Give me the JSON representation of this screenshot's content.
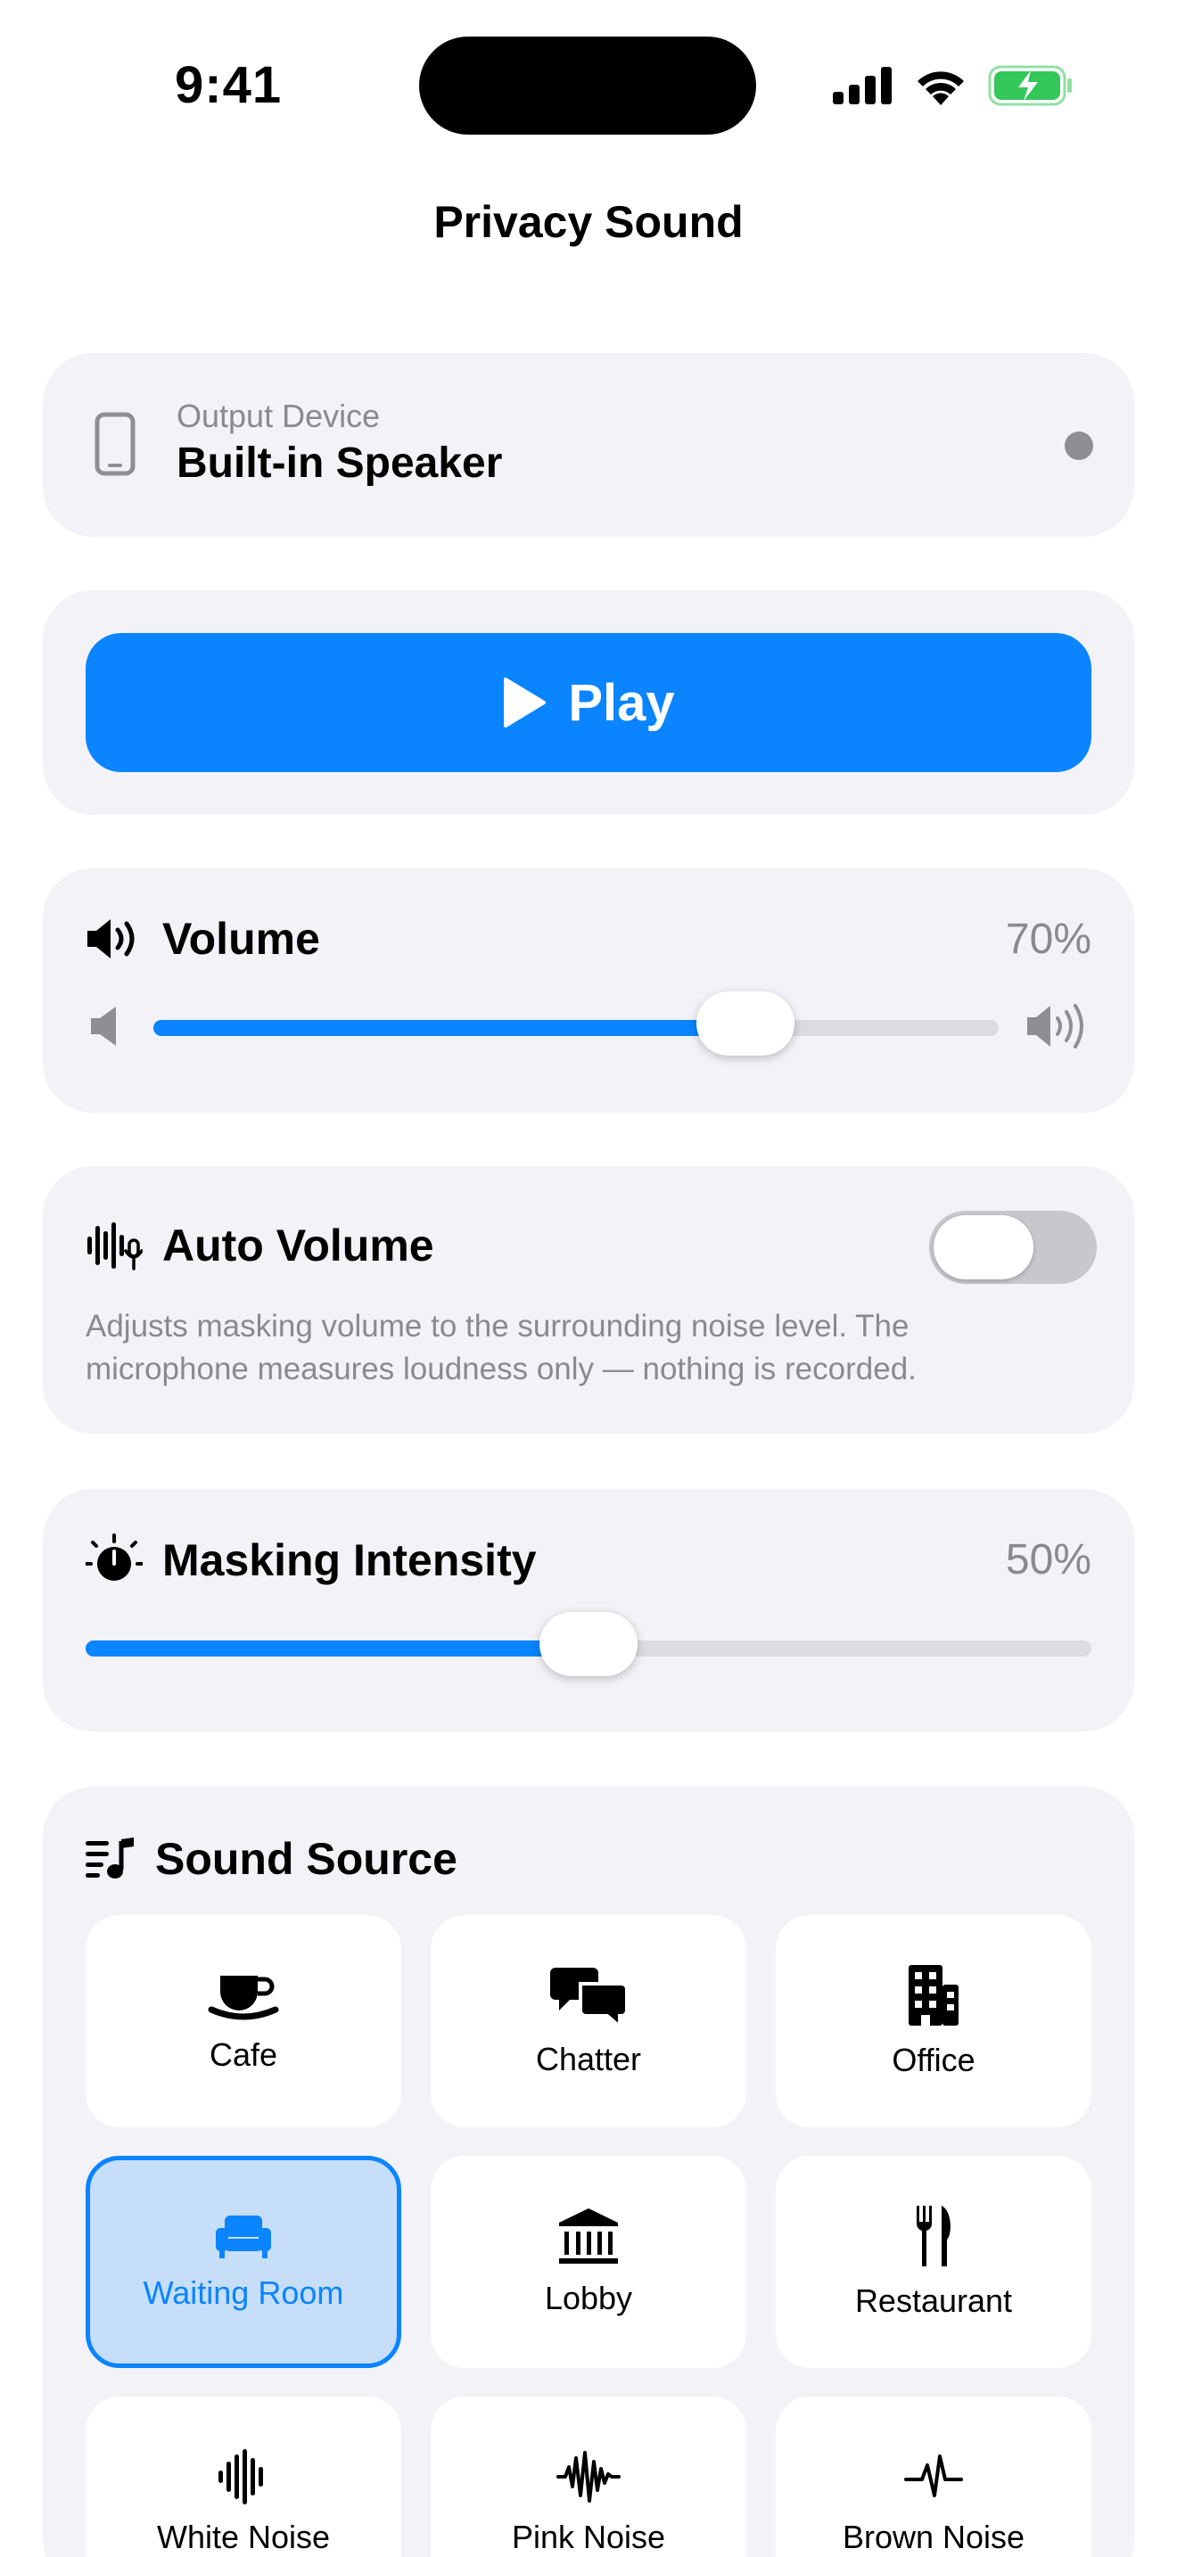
{
  "status_bar": {
    "time": "9:41"
  },
  "nav": {
    "title": "Privacy Sound"
  },
  "output_device": {
    "label": "Output Device",
    "value": "Built-in Speaker",
    "icon": "phone-icon"
  },
  "play": {
    "label": "Play",
    "icon": "play-icon"
  },
  "volume": {
    "title": "Volume",
    "percent_text": "70%",
    "level": 0.7
  },
  "auto_volume": {
    "title": "Auto Volume",
    "enabled": false,
    "description": "Adjusts masking volume to the surrounding noise level. The microphone measures loudness only — nothing is recorded."
  },
  "masking": {
    "title": "Masking Intensity",
    "percent_text": "50%",
    "level": 0.5
  },
  "sound_source": {
    "title": "Sound Source",
    "selected": "Waiting Room",
    "tiles": [
      {
        "label": "Cafe",
        "icon": "coffee-cup-icon"
      },
      {
        "label": "Chatter",
        "icon": "chat-bubbles-icon"
      },
      {
        "label": "Office",
        "icon": "office-building-icon"
      },
      {
        "label": "Waiting Room",
        "icon": "sofa-icon"
      },
      {
        "label": "Lobby",
        "icon": "building-columns-icon"
      },
      {
        "label": "Restaurant",
        "icon": "fork-knife-icon"
      },
      {
        "label": "White Noise",
        "icon": "waveform-icon"
      },
      {
        "label": "Pink Noise",
        "icon": "noise-wave-icon"
      },
      {
        "label": "Brown Noise",
        "icon": "pulse-wave-icon"
      }
    ]
  },
  "colors": {
    "accent": "#0a84ff",
    "card": "#f2f2f7",
    "secondary_text": "#8a8a8e",
    "selected_tile": "#c6def8",
    "battery": "#34c759"
  }
}
